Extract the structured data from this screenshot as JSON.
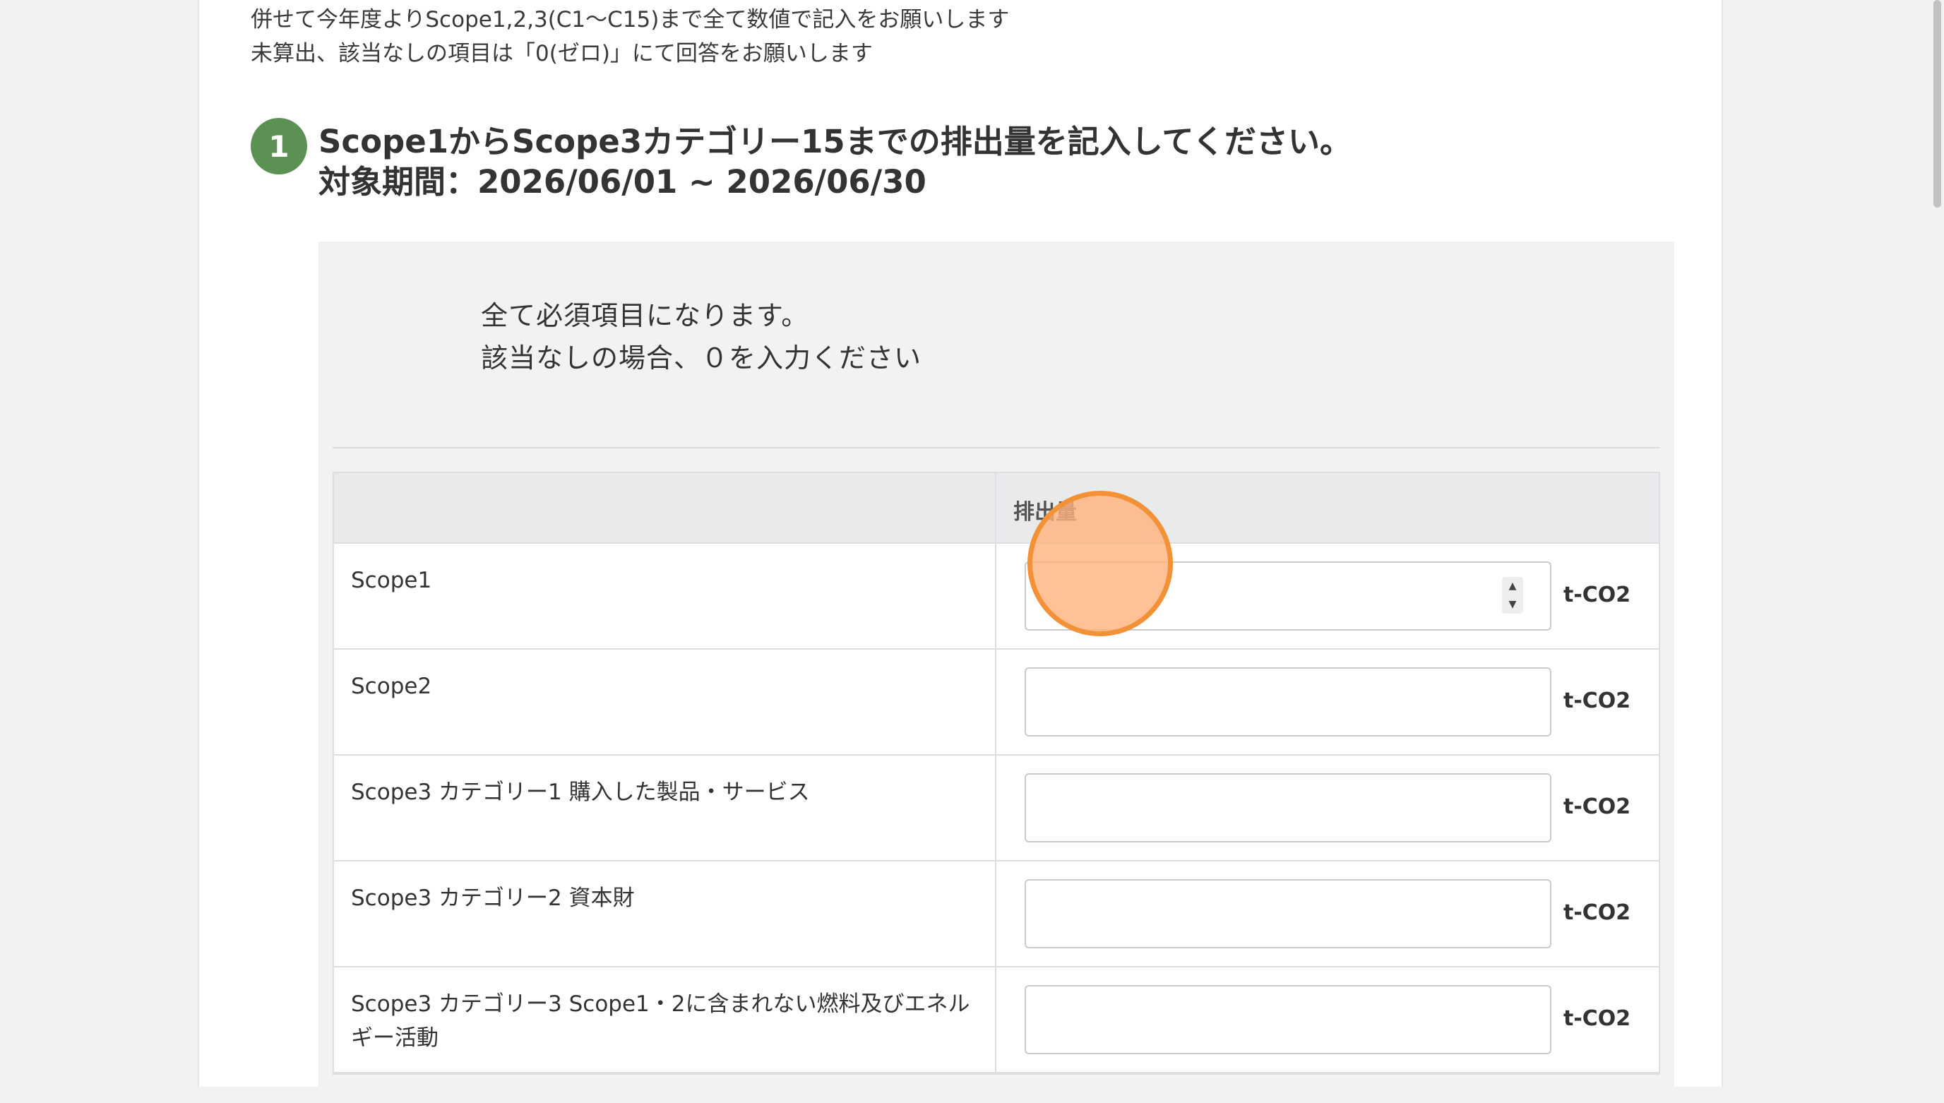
{
  "intro": {
    "line1": "併せて今年度よりScope1,2,3(C1〜C15)まで全て数値で記入をお願いします",
    "line2": "未算出、該当なしの項目は「0(ゼロ)」にて回答をお願いします"
  },
  "section": {
    "number": "1",
    "title_line1": "Scope1からScope3カテゴリー15までの排出量を記入してください。",
    "title_line2": "対象期間：2026/06/01 ~ 2026/06/30"
  },
  "notice": {
    "line1": "全て必須項目になります。",
    "line2": "該当なしの場合、０を入力ください"
  },
  "table": {
    "header_label": "",
    "header_value": "排出量",
    "rows": [
      {
        "label": "Scope1",
        "value": "",
        "unit": "t-CO2"
      },
      {
        "label": "Scope2",
        "value": "",
        "unit": "t-CO2"
      },
      {
        "label": "Scope3 カテゴリー1 購入した製品・サービス",
        "value": "",
        "unit": "t-CO2"
      },
      {
        "label": "Scope3 カテゴリー2 資本財",
        "value": "",
        "unit": "t-CO2"
      },
      {
        "label": "Scope3 カテゴリー3 Scope1・2に含まれない燃料及びエネルギー活動",
        "value": "",
        "unit": "t-CO2"
      }
    ]
  },
  "icons": {
    "spinner_up": "▲",
    "spinner_down": "▼"
  },
  "colors": {
    "badge": "#5b9153",
    "click_indicator": "#f39136",
    "panel_bg": "#f2f2f2"
  }
}
